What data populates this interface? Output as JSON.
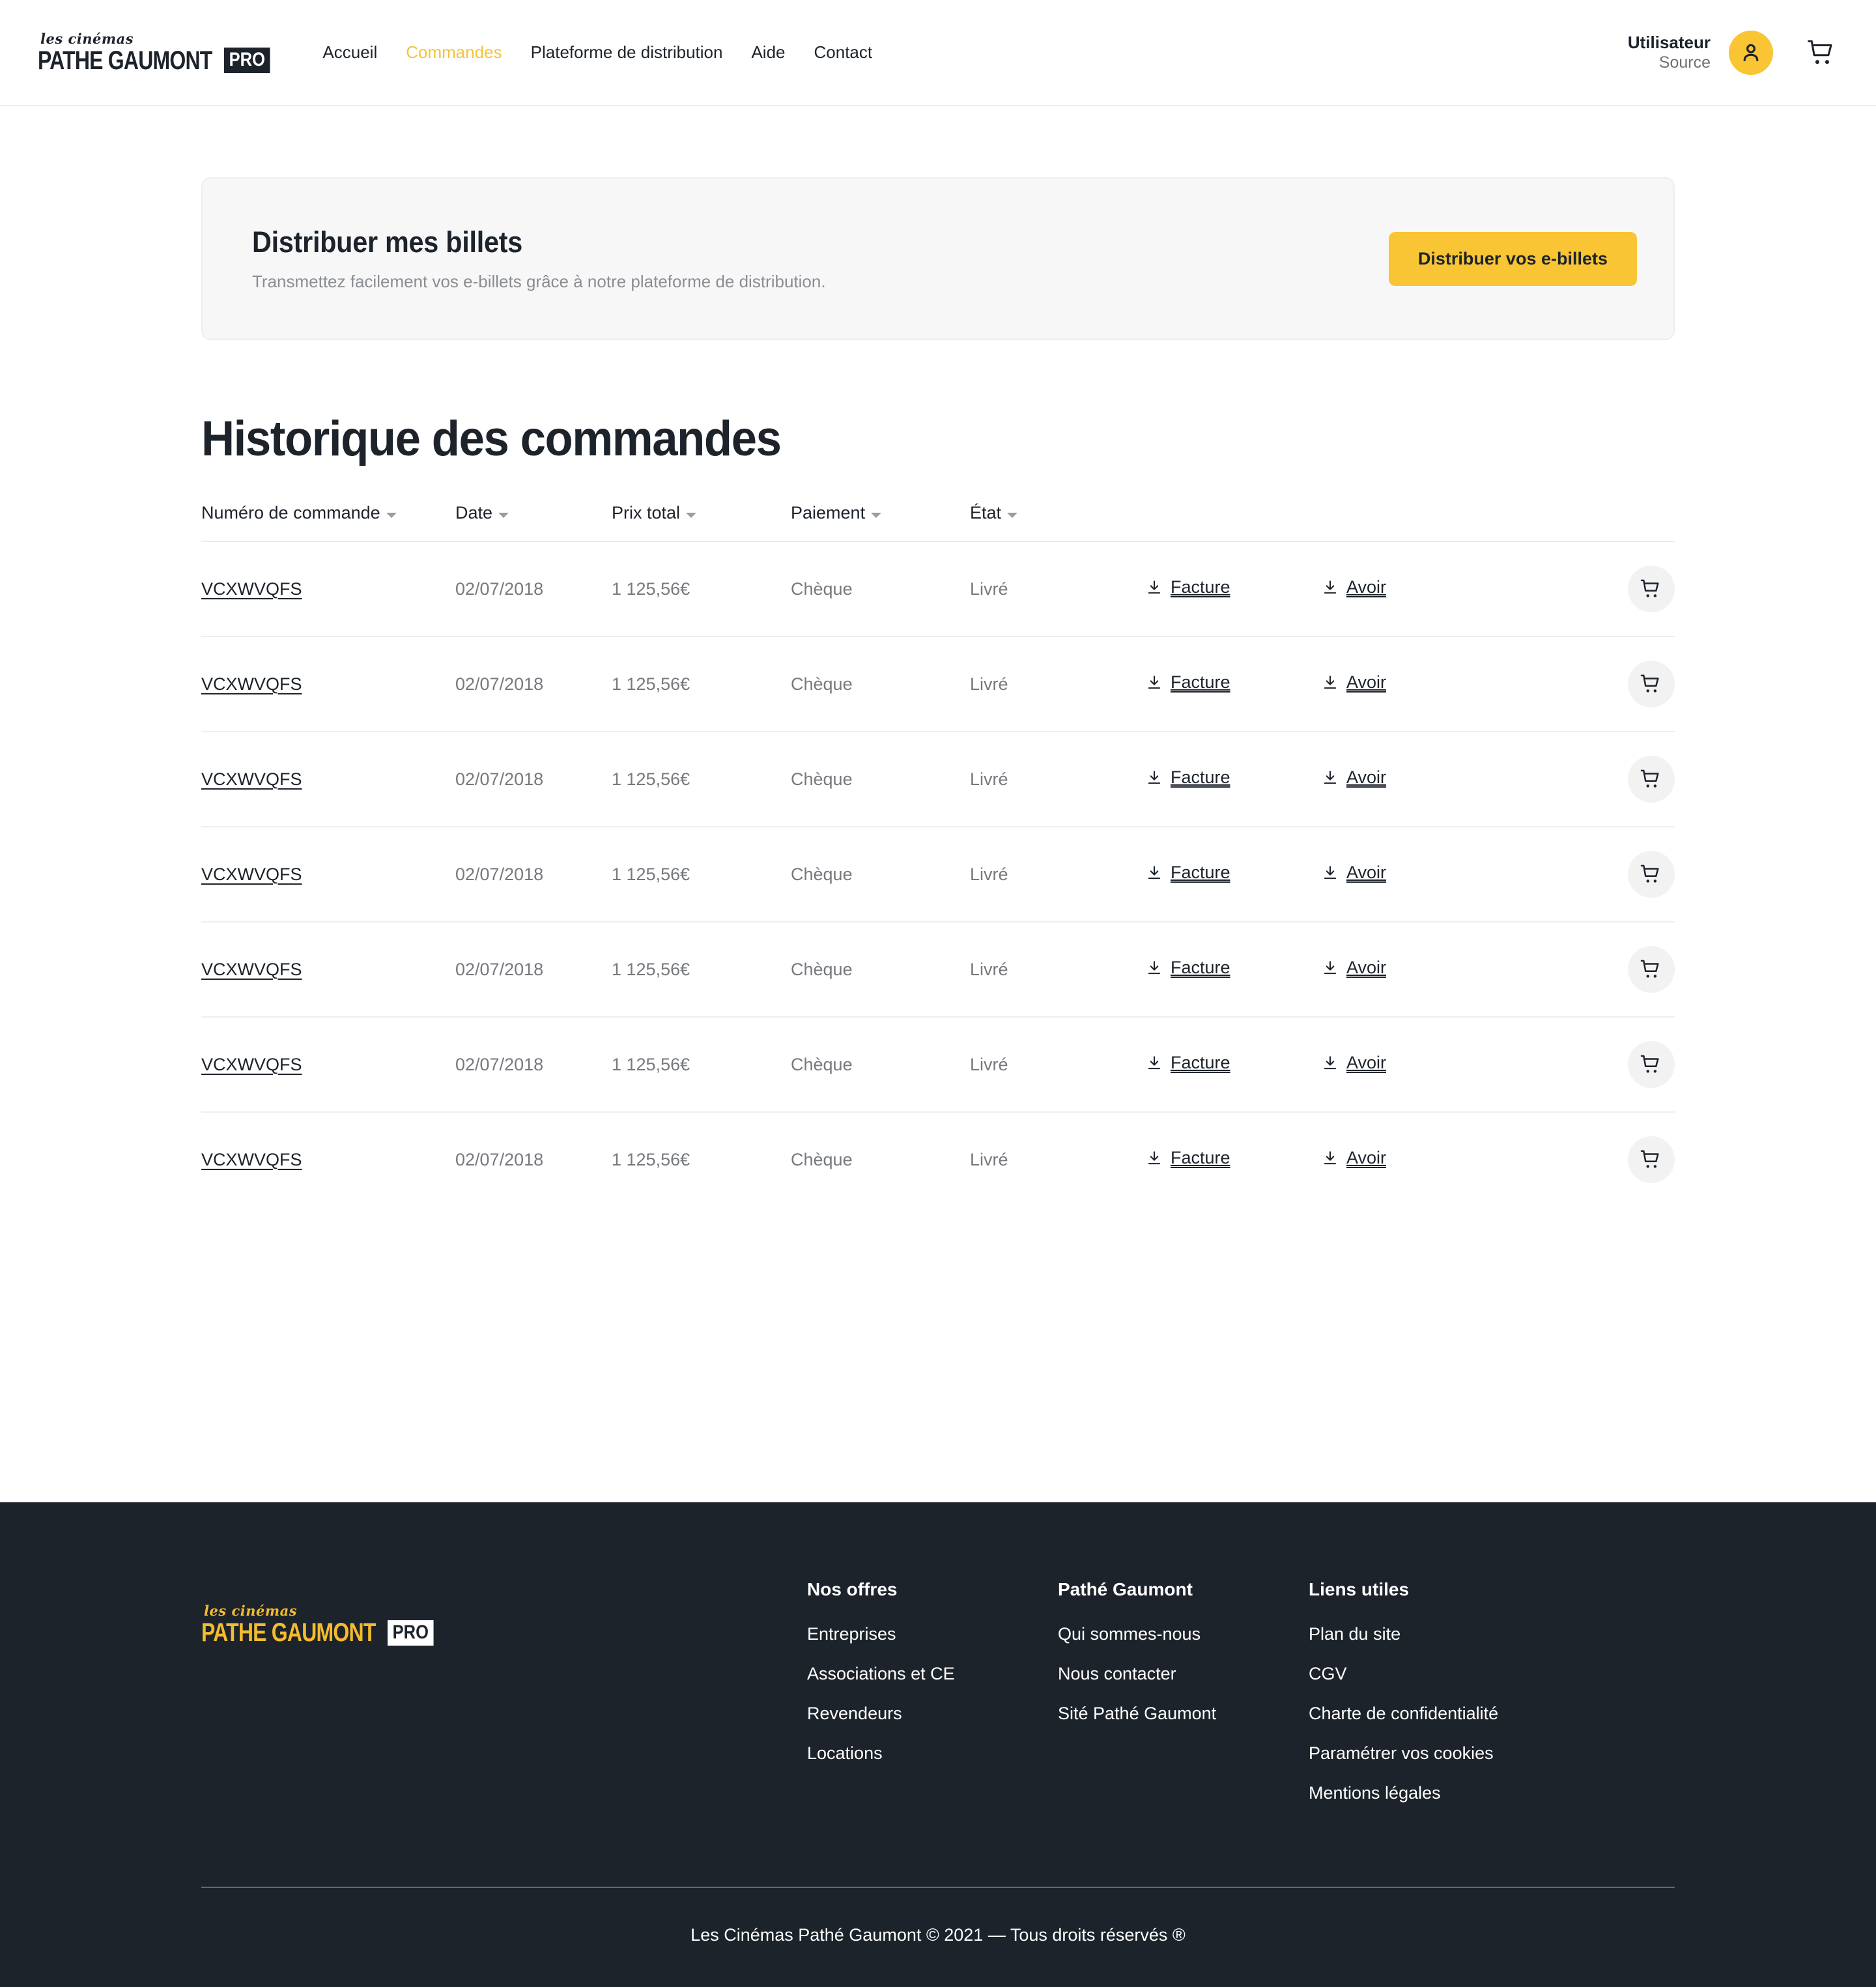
{
  "brand": {
    "script": "les cinémas",
    "word": "PATHE GAUMONT",
    "badge": "PRO"
  },
  "header": {
    "nav": [
      {
        "label": "Accueil",
        "active": false
      },
      {
        "label": "Commandes",
        "active": true
      },
      {
        "label": "Plateforme de distribution",
        "active": false
      },
      {
        "label": "Aide",
        "active": false
      },
      {
        "label": "Contact",
        "active": false
      }
    ],
    "user_name": "Utilisateur",
    "user_role": "Source",
    "avatar_icon": "person-icon",
    "cart_icon": "shopping-cart-icon",
    "accent_color": "#f9c534"
  },
  "banner": {
    "title": "Distribuer mes billets",
    "subtitle": "Transmettez facilement vos e-billets grâce à notre plateforme de distribution.",
    "button_label": "Distribuer vos e-billets",
    "button_color": "#f9c534",
    "background": "#f7f7f8"
  },
  "main": {
    "title": "Historique des commandes",
    "table": {
      "columns": [
        {
          "label": "Numéro de commande",
          "sortable": true
        },
        {
          "label": "Date",
          "sortable": true
        },
        {
          "label": "Prix total",
          "sortable": true
        },
        {
          "label": "Paiement",
          "sortable": true
        },
        {
          "label": "État",
          "sortable": true
        }
      ],
      "row_actions": {
        "invoice_label": "Facture",
        "credit_label": "Avoir",
        "reorder_icon": "shopping-cart-icon",
        "download_icon": "download-icon"
      },
      "rows": [
        {
          "order": "VCXWVQFS",
          "date": "02/07/2018",
          "total": "1 125,56€",
          "payment": "Chèque",
          "status": "Livré",
          "invoice": "Facture",
          "credit": "Avoir"
        },
        {
          "order": "VCXWVQFS",
          "date": "02/07/2018",
          "total": "1 125,56€",
          "payment": "Chèque",
          "status": "Livré",
          "invoice": "Facture",
          "credit": "Avoir"
        },
        {
          "order": "VCXWVQFS",
          "date": "02/07/2018",
          "total": "1 125,56€",
          "payment": "Chèque",
          "status": "Livré",
          "invoice": "Facture",
          "credit": "Avoir"
        },
        {
          "order": "VCXWVQFS",
          "date": "02/07/2018",
          "total": "1 125,56€",
          "payment": "Chèque",
          "status": "Livré",
          "invoice": "Facture",
          "credit": "Avoir"
        },
        {
          "order": "VCXWVQFS",
          "date": "02/07/2018",
          "total": "1 125,56€",
          "payment": "Chèque",
          "status": "Livré",
          "invoice": "Facture",
          "credit": "Avoir"
        },
        {
          "order": "VCXWVQFS",
          "date": "02/07/2018",
          "total": "1 125,56€",
          "payment": "Chèque",
          "status": "Livré",
          "invoice": "Facture",
          "credit": "Avoir"
        },
        {
          "order": "VCXWVQFS",
          "date": "02/07/2018",
          "total": "1 125,56€",
          "payment": "Chèque",
          "status": "Livré",
          "invoice": "Facture",
          "credit": "Avoir"
        }
      ]
    }
  },
  "footer": {
    "background": "#1d232b",
    "logo_color": "#f5bb2e",
    "columns": [
      {
        "heading": "Nos offres",
        "links": [
          "Entreprises",
          "Associations et CE",
          "Revendeurs",
          "Locations"
        ]
      },
      {
        "heading": "Pathé Gaumont",
        "links": [
          "Qui sommes-nous",
          "Nous contacter",
          "Sité Pathé Gaumont"
        ]
      },
      {
        "heading": "Liens utiles",
        "links": [
          "Plan du site",
          "CGV",
          "Charte de confidentialité",
          "Paramétrer vos cookies",
          "Mentions légales"
        ]
      }
    ],
    "copyright": "Les Cinémas Pathé Gaumont © 2021 — Tous droits réservés ®"
  }
}
